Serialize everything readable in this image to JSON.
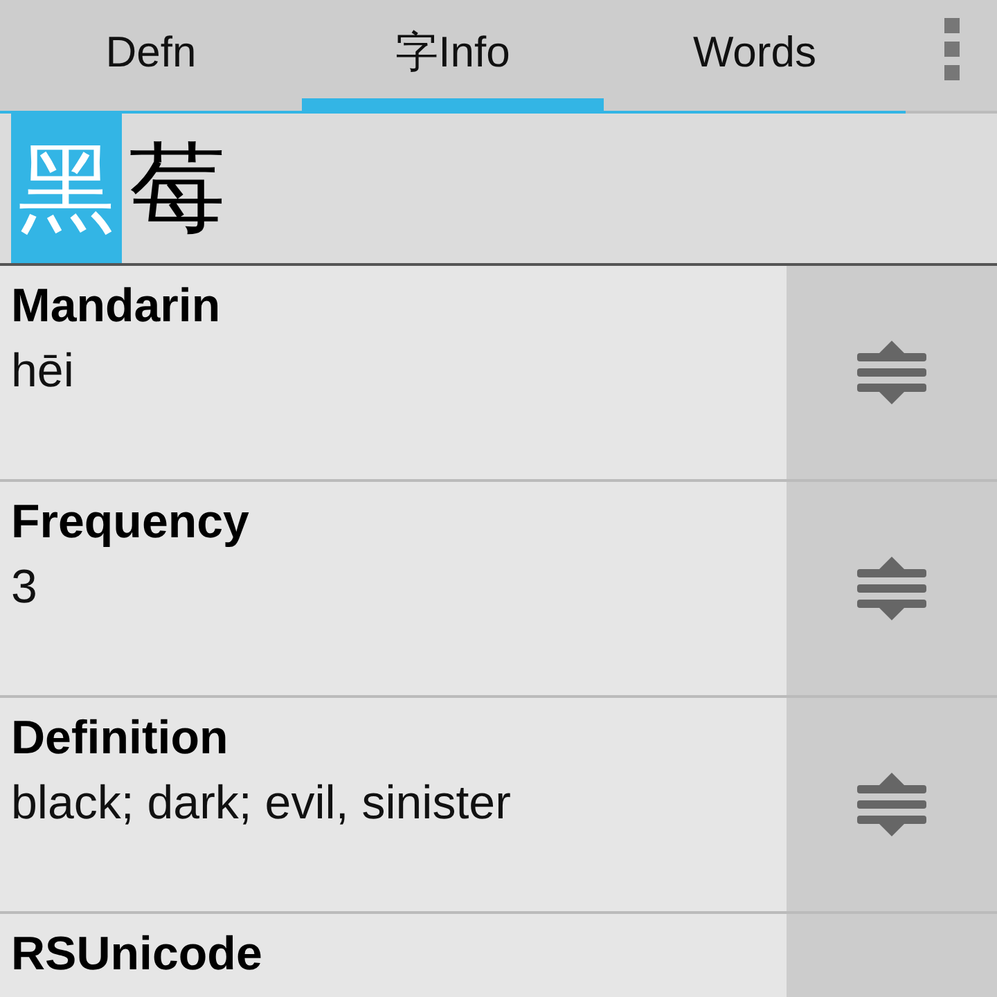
{
  "tabs": [
    {
      "label": "Defn",
      "selected": false
    },
    {
      "label": "字Info",
      "selected": true
    },
    {
      "label": "Words",
      "selected": false
    }
  ],
  "characters": [
    {
      "char": "黑",
      "selected": true
    },
    {
      "char": "莓",
      "selected": false
    }
  ],
  "rows": [
    {
      "label": "Mandarin",
      "value": "hēi"
    },
    {
      "label": "Frequency",
      "value": "3"
    },
    {
      "label": "Definition",
      "value": "black; dark; evil, sinister"
    },
    {
      "label": "RSUnicode"
    }
  ]
}
